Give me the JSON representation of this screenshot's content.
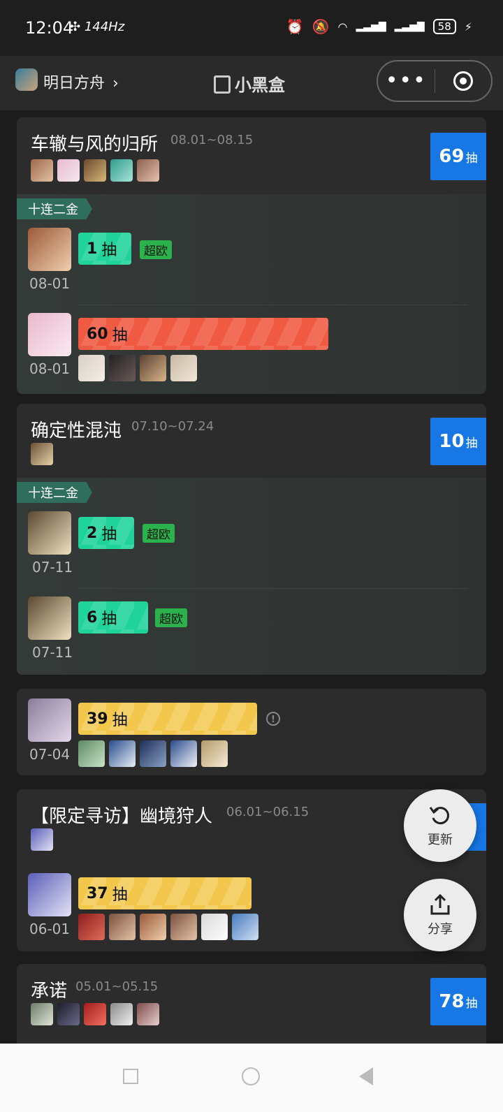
{
  "status_bar": {
    "time": "12:04",
    "refresh": "144Hz",
    "battery": "58"
  },
  "nav": {
    "app_name": "明日方舟",
    "brand": "小黑盒"
  },
  "banners": [
    {
      "title": "车辙与风的归所",
      "date": "08.01~08.15",
      "total": "69",
      "total_unit": "抽",
      "ribbon": "十连二金",
      "pulls": [
        {
          "date": "08-01",
          "count": "1",
          "unit": "抽",
          "badge": "超欧",
          "fraction": 0.12
        },
        {
          "date": "08-01",
          "count": "60",
          "unit": "抽",
          "fraction": 0.6
        }
      ]
    },
    {
      "title": "确定性混沌",
      "date": "07.10~07.24",
      "total": "10",
      "total_unit": "抽",
      "ribbon": "十连二金",
      "pulls": [
        {
          "date": "07-11",
          "count": "2",
          "unit": "抽",
          "badge": "超欧",
          "fraction": 0.13
        },
        {
          "date": "07-11",
          "count": "6",
          "unit": "抽",
          "badge": "超欧",
          "fraction": 0.17
        }
      ]
    },
    {
      "pulls": [
        {
          "date": "07-04",
          "count": "39",
          "unit": "抽",
          "info": "!",
          "fraction": 0.43
        }
      ]
    },
    {
      "title": "【限定寻访】幽境狩人",
      "date": "06.01~06.15",
      "pulls": [
        {
          "date": "06-01",
          "count": "37",
          "unit": "抽",
          "fraction": 0.41
        }
      ]
    },
    {
      "title": "承诺",
      "date": "05.01~05.15",
      "total": "78",
      "total_unit": "抽"
    }
  ],
  "fab": {
    "refresh_label": "更新",
    "share_label": "分享"
  },
  "colors": {
    "accent_blue": "#1677e5",
    "green": "#1fd39a",
    "red": "#f05a42",
    "yellow": "#f2c74b",
    "badge_green": "#2bb24c"
  }
}
